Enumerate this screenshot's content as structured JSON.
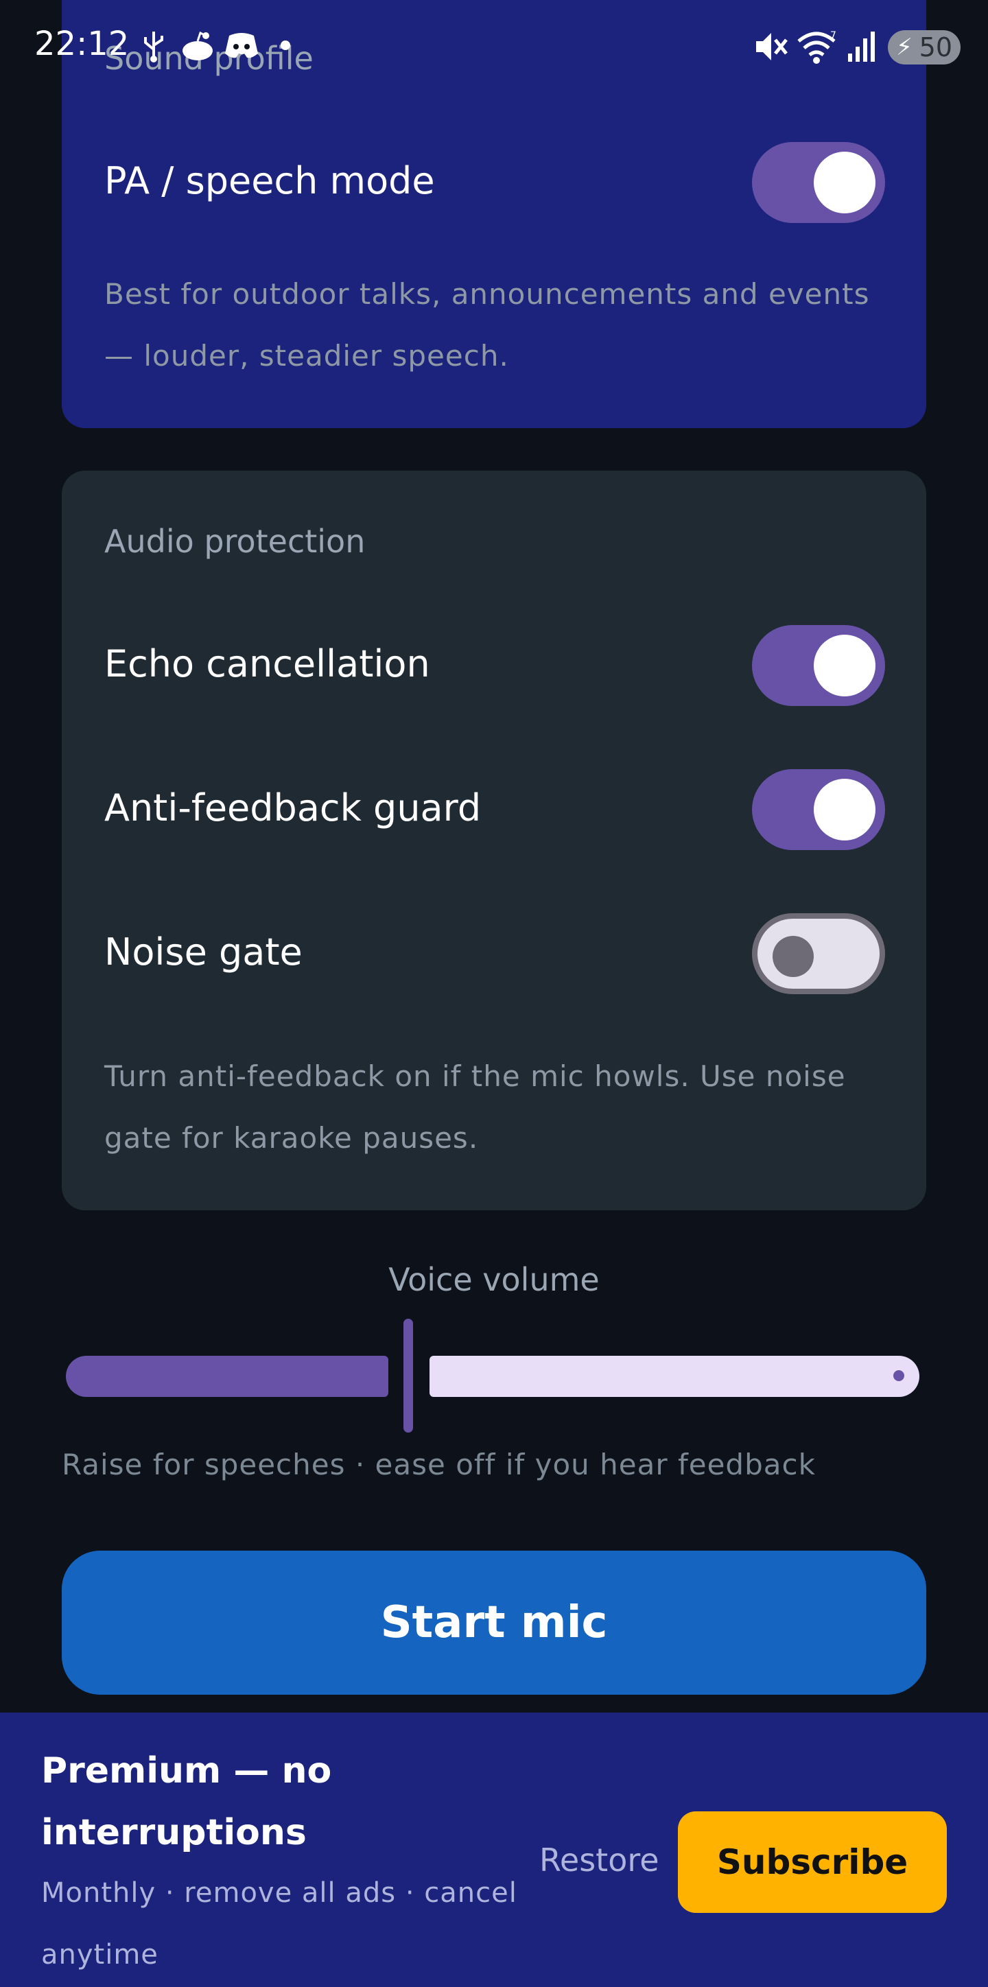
{
  "status_bar": {
    "time": "22:12",
    "battery_level": "50",
    "icons": [
      "usb-icon",
      "reddit-icon",
      "discord-icon",
      "notification-dot-icon",
      "mute-icon",
      "wifi-icon",
      "signal-icon",
      "battery-charging-icon"
    ]
  },
  "sound_profile": {
    "title": "Sound profile",
    "pa_mode_label": "PA / speech mode",
    "pa_mode_on": true,
    "description": "Best for outdoor talks, announcements and events — louder, steadier speech."
  },
  "audio_protection": {
    "title": "Audio protection",
    "echo_label": "Echo cancellation",
    "echo_on": true,
    "anti_feedback_label": "Anti-feedback guard",
    "anti_feedback_on": true,
    "noise_gate_label": "Noise gate",
    "noise_gate_on": false,
    "description": "Turn anti-feedback on if the mic howls. Use noise gate for karaoke pauses."
  },
  "volume": {
    "label": "Voice volume",
    "level_fraction": 0.38,
    "hint": "Raise for speeches · ease off if you hear feedback"
  },
  "start_button_label": "Start mic",
  "premium": {
    "title": "Premium — no interruptions",
    "subtitle": "Monthly · remove all ads · cancel anytime",
    "restore_label": "Restore",
    "subscribe_label": "Subscribe"
  },
  "colors": {
    "background": "#0d1119",
    "sound_card": "#1b237c",
    "protection_card": "#1f2a32",
    "toggle_on": "#6752a8",
    "primary_button": "#1565c0",
    "subscribe_button": "#ffb300"
  }
}
